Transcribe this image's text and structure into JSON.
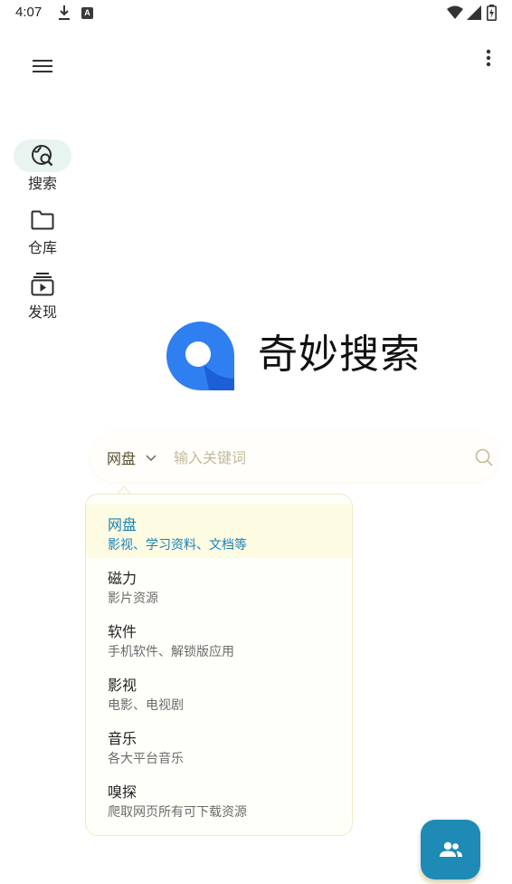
{
  "status_bar": {
    "time": "4:07",
    "icons": [
      "download-icon",
      "app-notification-icon",
      "wifi-icon",
      "signal-icon",
      "battery-charging-icon"
    ],
    "notification_letter": "A"
  },
  "toolbar": {
    "menu_icon": "hamburger-menu-icon",
    "more_icon": "more-vertical-icon"
  },
  "nav": {
    "items": [
      {
        "label": "搜索",
        "icon": "globe-search-icon",
        "active": true
      },
      {
        "label": "仓库",
        "icon": "folder-icon",
        "active": false
      },
      {
        "label": "发现",
        "icon": "play-box-icon",
        "active": false
      }
    ]
  },
  "branding": {
    "title": "奇妙搜索",
    "logo_colors": {
      "outer": "#2f7ff0",
      "inner": "#ffffff",
      "accent": "#1c5fd6"
    }
  },
  "search": {
    "category": "网盘",
    "placeholder": "输入关键词"
  },
  "dropdown": {
    "options": [
      {
        "title": "网盘",
        "subtitle": "影视、学习资料、文档等",
        "selected": true
      },
      {
        "title": "磁力",
        "subtitle": "影片资源",
        "selected": false
      },
      {
        "title": "软件",
        "subtitle": "手机软件、解锁版应用",
        "selected": false
      },
      {
        "title": "影视",
        "subtitle": "电影、电视剧",
        "selected": false
      },
      {
        "title": "音乐",
        "subtitle": "各大平台音乐",
        "selected": false
      },
      {
        "title": "嗅探",
        "subtitle": "爬取网页所有可下载资源",
        "selected": false
      }
    ]
  },
  "fab": {
    "icon": "group-icon"
  },
  "colors": {
    "accent": "#1f8ab5",
    "selected_text": "#1a82b8",
    "selected_bg": "#fdfbe2",
    "placeholder": "#c4b99b"
  }
}
